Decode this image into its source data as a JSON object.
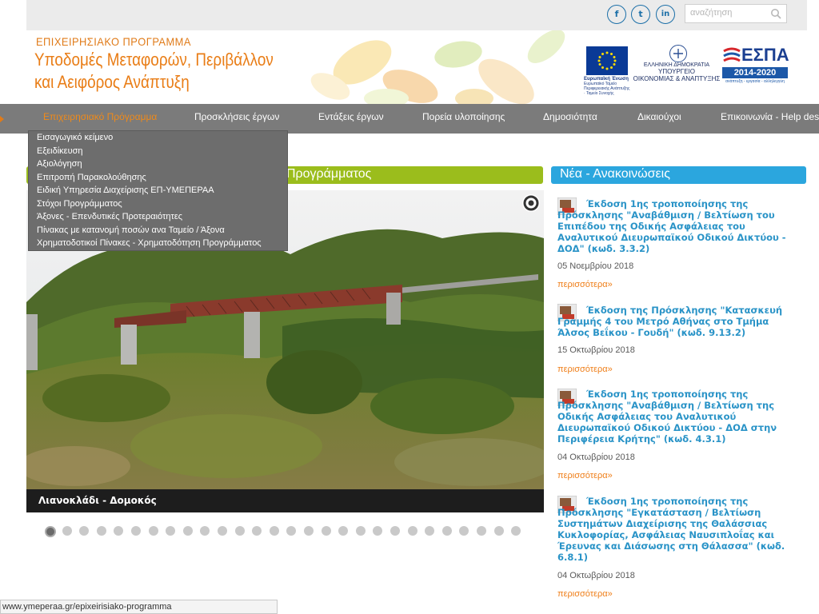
{
  "colors": {
    "accent": "#e97d16",
    "nav_bg": "#7b7b7b",
    "news_link": "#2993c7",
    "section_green": "#9bbd1c",
    "section_blue": "#2ba6de"
  },
  "social": [
    {
      "icon": "facebook-icon",
      "glyph": "f"
    },
    {
      "icon": "twitter-icon",
      "glyph": "t"
    },
    {
      "icon": "linkedin-icon",
      "glyph": "in"
    }
  ],
  "search": {
    "placeholder": "αναζήτηση"
  },
  "header": {
    "small_title": "ΕΠΙΧΕΙΡΗΣΙΑΚΟ ΠΡΟΓΡΑΜΜΑ",
    "title_line1": "Υποδομές Μεταφορών, Περιβάλλον",
    "title_line2": "και Αειφόρος Ανάπτυξη",
    "eu_label": "Ευρωπαϊκή Ένωση",
    "eu_sub": "Ευρωπαϊκό Ταμείο Περιφερειακής Ανάπτυξης · Ταμείο Συνοχής",
    "gr_line1": "ΕΛΛΗΝΙΚΗ ΔΗΜΟΚΡΑΤΙΑ",
    "gr_line2": "ΥΠΟΥΡΓΕΙΟ",
    "gr_line3": "ΟΙΚΟΝΟΜΙΑΣ & ΑΝΑΠΤΥΞΗΣ",
    "espa_title": "ΕΣΠΑ",
    "espa_years": "2014-2020",
    "espa_slogan": "ανάπτυξη - εργασία - αλληλεγγύη"
  },
  "nav": [
    "Επιχειρησιακό Πρόγραμμα",
    "Προσκλήσεις έργων",
    "Εντάξεις έργων",
    "Πορεία υλοποίησης",
    "Δημοσιότητα",
    "Δικαιούχοι",
    "Επικοινωνία - Help desk"
  ],
  "dropdown": [
    "Εισαγωγικό κείμενο",
    "Εξειδίκευση",
    "Αξιολόγηση",
    "Επιτροπή Παρακολούθησης",
    "Ειδική Υπηρεσία Διαχείρισης ΕΠ-ΥΜΕΠΕΡΑΑ",
    "Στόχοι Προγράμματος",
    "Άξονες - Επενδυτικές Προτεραιότητες",
    "Πίνακας με κατανομή ποσών ανα Ταμείο / Άξονα",
    "Χρηματοδοτικοί Πίνακες - Χρηματοδότηση Προγράμματος"
  ],
  "sections": {
    "program_title": "Προγράμματος",
    "news_title": "Νέα - Ανακοινώσεις"
  },
  "slider": {
    "caption": "Λιανοκλάδι - Δομοκός",
    "slide_count": 28,
    "active_slide": 1
  },
  "news": [
    {
      "title": "Έκδοση 1ης τροποποίησης της Πρόσκλησης \"Αναβάθμιση / Βελτίωση του Επιπέδου της Οδικής Ασφάλειας του Αναλυτικού Διευρωπαϊκού Οδικού Δικτύου - ΔΟΔ\" (κωδ. 3.3.2)",
      "date": "05 Νοεμβρίου 2018",
      "more": "περισσότερα»"
    },
    {
      "title": "Έκδοση της Πρόσκλησης \"Κατασκευή Γραμμής 4 του Μετρό Αθήνας στο Τμήμα Άλσος Βεΐκου - Γουδή\" (κωδ. 9.13.2)",
      "date": "15 Οκτωβρίου 2018",
      "more": "περισσότερα»"
    },
    {
      "title": "Έκδοση 1ης τροποποίησης της Πρόσκλησης \"Αναβάθμιση / Βελτίωση της Οδικής Ασφάλειας του Αναλυτικού Διευρωπαϊκού Οδικού Δικτύου - ΔΟΔ στην Περιφέρεια Κρήτης\" (κωδ. 4.3.1)",
      "date": "04 Οκτωβρίου 2018",
      "more": "περισσότερα»"
    },
    {
      "title": "Έκδοση 1ης τροποποίησης της Πρόσκλησης \"Εγκατάσταση / Βελτίωση Συστημάτων Διαχείρισης της Θαλάσσιας Κυκλοφορίας, Ασφάλειας Ναυσιπλοΐας και Έρευνας και Διάσωσης στη Θάλασσα\" (κωδ. 6.8.1)",
      "date": "04 Οκτωβρίου 2018",
      "more": "περισσότερα»"
    }
  ],
  "statusbar": {
    "url": "www.ymeperaa.gr/epixeirisiako-programma"
  }
}
